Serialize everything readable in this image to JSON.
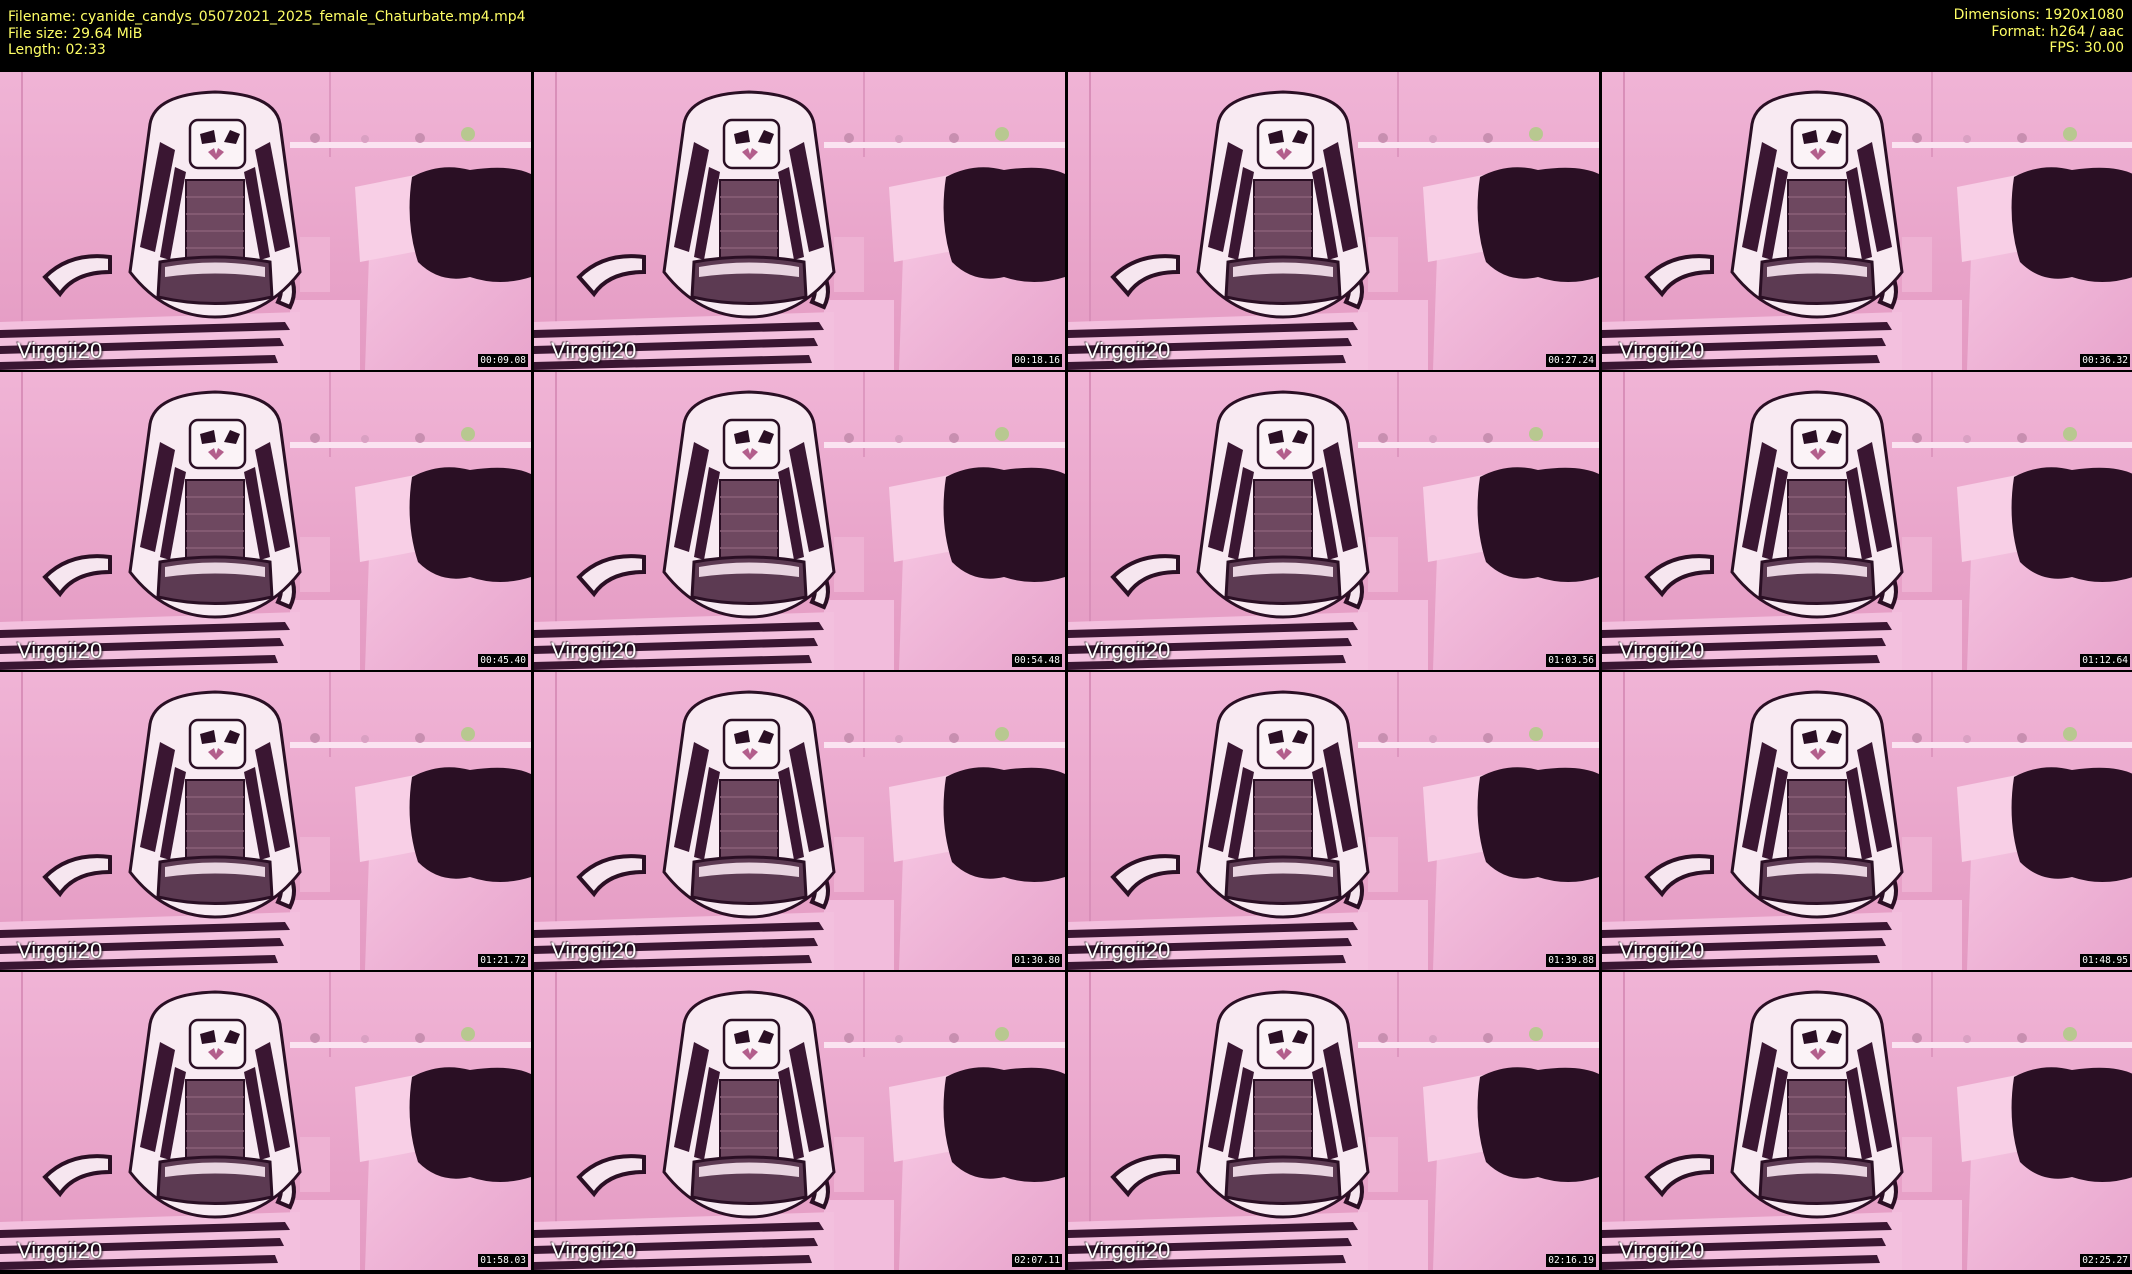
{
  "info": {
    "filename": "Filename: cyanide_candys_05072021_2025_female_Chaturbate.mp4.mp4",
    "file_size": "File size: 29.64 MiB",
    "length": "Length: 02:33",
    "dimensions": "Dimensions: 1920x1080",
    "format": "Format: h264 / aac",
    "fps": "FPS: 30.00"
  },
  "colors": {
    "header_text": "#ffff66",
    "background": "#000000",
    "frame_tint": "#e6a3c8"
  },
  "thumbnails": [
    {
      "watermark": "Virggii20",
      "timestamp": "00:09.08"
    },
    {
      "watermark": "Virggii20",
      "timestamp": "00:18.16"
    },
    {
      "watermark": "Virggii20",
      "timestamp": "00:27.24"
    },
    {
      "watermark": "Virggii20",
      "timestamp": "00:36.32"
    },
    {
      "watermark": "Virggii20",
      "timestamp": "00:45.40"
    },
    {
      "watermark": "Virggii20",
      "timestamp": "00:54.48"
    },
    {
      "watermark": "Virggii20",
      "timestamp": "01:03.56"
    },
    {
      "watermark": "Virggii20",
      "timestamp": "01:12.64"
    },
    {
      "watermark": "Virggii20",
      "timestamp": "01:21.72"
    },
    {
      "watermark": "Virggii20",
      "timestamp": "01:30.80"
    },
    {
      "watermark": "Virggii20",
      "timestamp": "01:39.88"
    },
    {
      "watermark": "Virggii20",
      "timestamp": "01:48.95"
    },
    {
      "watermark": "Virggii20",
      "timestamp": "01:58.03"
    },
    {
      "watermark": "Virggii20",
      "timestamp": "02:07.11"
    },
    {
      "watermark": "Virggii20",
      "timestamp": "02:16.19"
    },
    {
      "watermark": "Virggii20",
      "timestamp": "02:25.27"
    }
  ]
}
